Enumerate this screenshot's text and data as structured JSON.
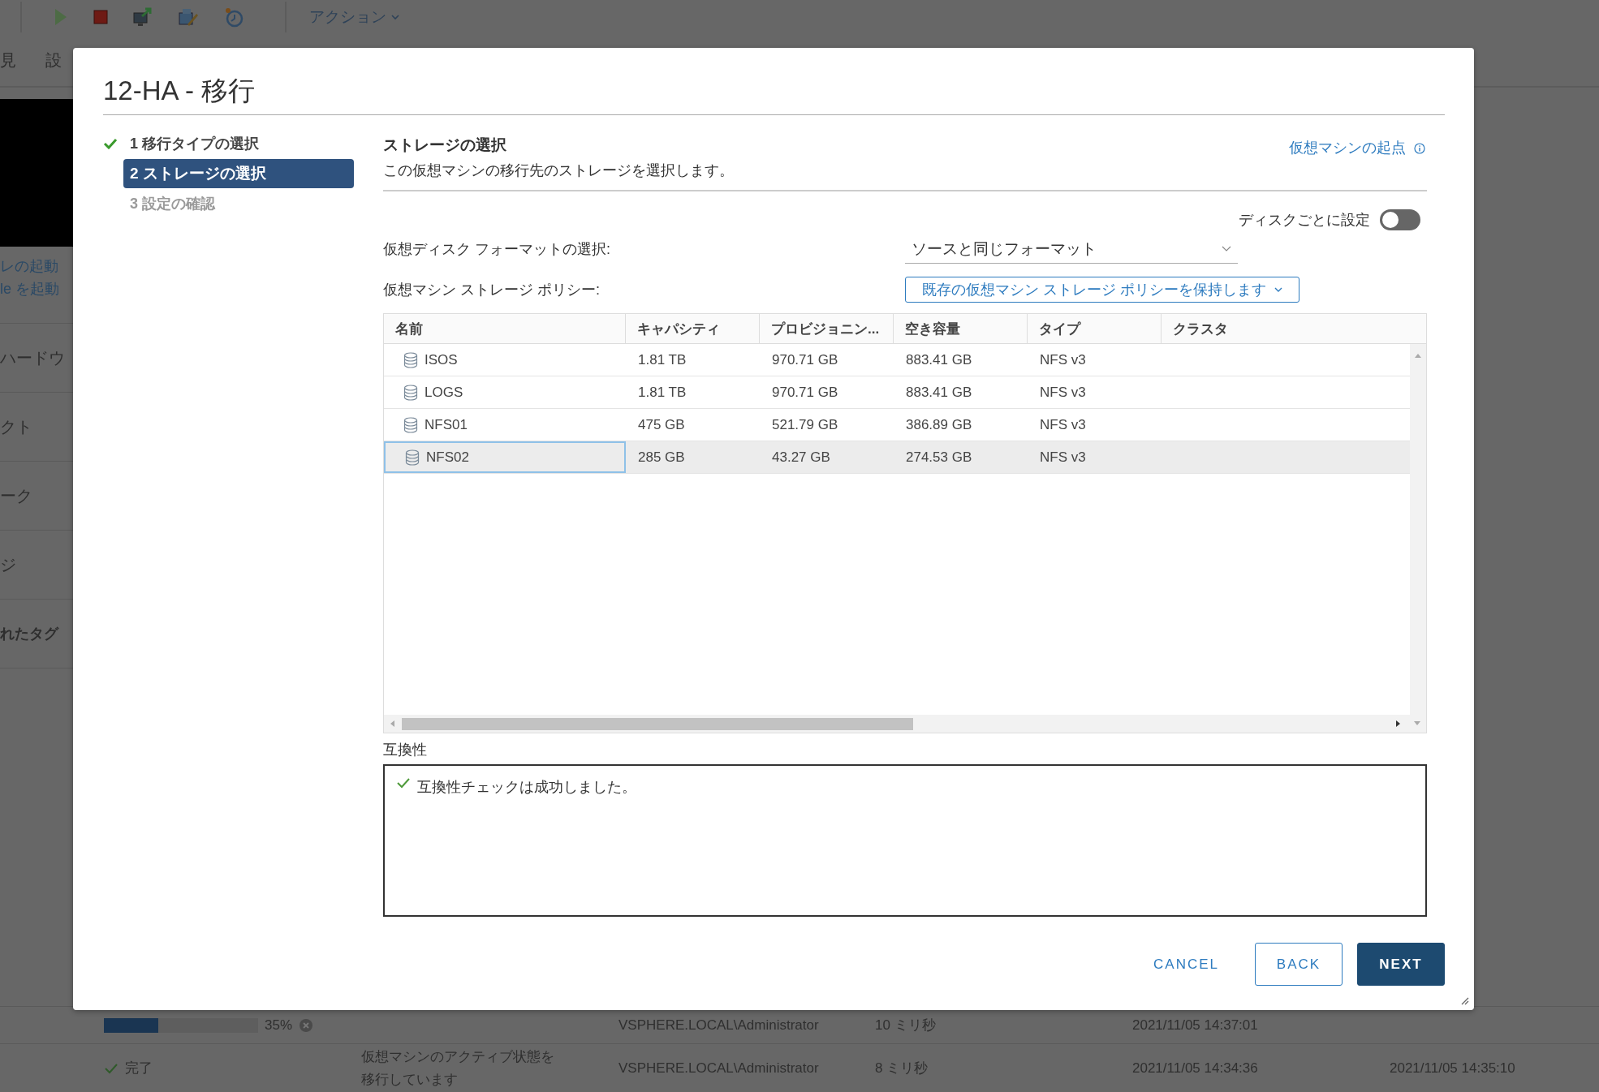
{
  "toolbar": {
    "actions_menu": "アクション"
  },
  "background_tabs": [
    "見",
    "設"
  ],
  "background_links": [
    "レの起動",
    "le を起動"
  ],
  "background_items": [
    {
      "label": "ハードウ",
      "bold": false
    },
    {
      "label": "クト",
      "bold": false
    },
    {
      "label": "ーク",
      "bold": false
    },
    {
      "label": "ジ",
      "bold": false
    },
    {
      "label": "れたタグ",
      "bold": true
    }
  ],
  "recent_tasks": [
    {
      "kind": "progress",
      "level": 0.35,
      "status": "35%",
      "initiator": "VSPHERE.LOCAL\\Administrator",
      "queued": "10 ミリ秒",
      "start": "2021/11/05 14:37:01"
    },
    {
      "kind": "done",
      "status": "完了",
      "details": [
        "仮想マシンのアクティブ状態を",
        "移行しています"
      ],
      "initiator": "VSPHERE.LOCAL\\Administrator",
      "queued": "8 ミリ秒",
      "start": "2021/11/05 14:34:36",
      "end": "2021/11/05 14:35:10"
    }
  ],
  "dialog": {
    "title": "12-HA - 移行",
    "steps": [
      {
        "label": "1 移行タイプの選択",
        "completed": true,
        "selected": false,
        "disabled": false
      },
      {
        "label": "2 ストレージの選択",
        "completed": false,
        "selected": true,
        "disabled": false
      },
      {
        "label": "3 設定の確認",
        "completed": false,
        "selected": false,
        "disabled": true
      }
    ],
    "section": {
      "title": "ストレージの選択",
      "description": "この仮想マシンの移行先のストレージを選択します。",
      "help_link": "仮想マシンの起点"
    },
    "per_disk_toggle": {
      "label": "ディスクごとに設定",
      "on": false
    },
    "disk_format": {
      "label": "仮想ディスク フォーマットの選択:",
      "value": "ソースと同じフォーマット"
    },
    "storage_policy": {
      "label": "仮想マシン ストレージ ポリシー:",
      "value": "既存の仮想マシン ストレージ ポリシーを保持します"
    },
    "table": {
      "columns": [
        "名前",
        "キャパシティ",
        "プロビジョニン...",
        "空き容量",
        "タイプ",
        "クラスタ"
      ],
      "rows": [
        {
          "name": "ISOS",
          "capacity": "1.81 TB",
          "provisioned": "970.71 GB",
          "free": "883.41 GB",
          "type": "NFS v3",
          "selected": false
        },
        {
          "name": "LOGS",
          "capacity": "1.81 TB",
          "provisioned": "970.71 GB",
          "free": "883.41 GB",
          "type": "NFS v3",
          "selected": false
        },
        {
          "name": "NFS01",
          "capacity": "475 GB",
          "provisioned": "521.79 GB",
          "free": "386.89 GB",
          "type": "NFS v3",
          "selected": false
        },
        {
          "name": "NFS02",
          "capacity": "285 GB",
          "provisioned": "43.27 GB",
          "free": "274.53 GB",
          "type": "NFS v3",
          "selected": true
        }
      ]
    },
    "compatibility": {
      "label": "互換性",
      "message": "互換性チェックは成功しました。",
      "passed": true
    },
    "buttons": [
      {
        "label": "CANCEL",
        "kind": "link"
      },
      {
        "label": "BACK",
        "kind": "outline"
      },
      {
        "label": "NEXT",
        "kind": "primary"
      }
    ]
  }
}
